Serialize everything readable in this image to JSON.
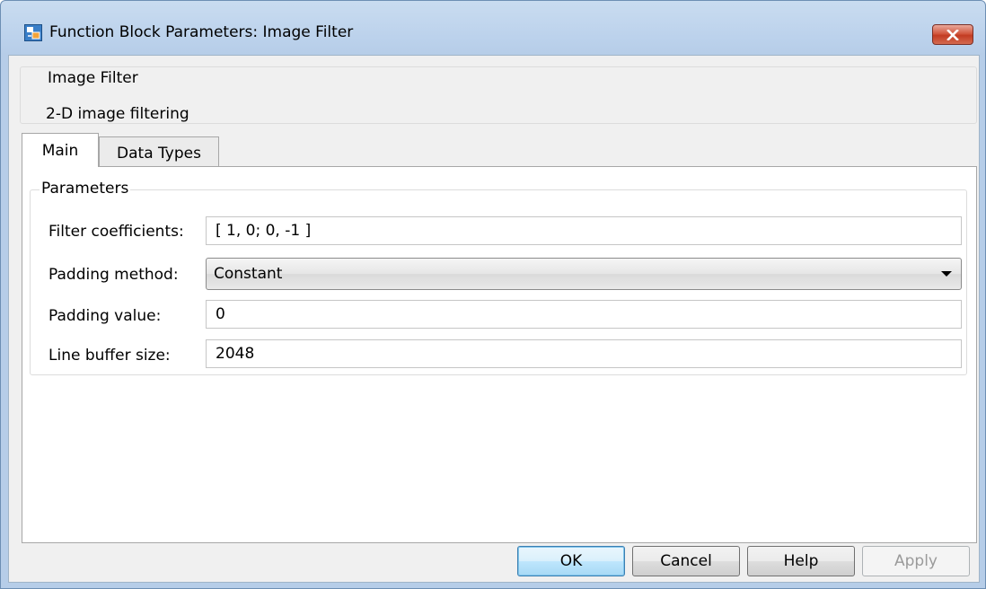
{
  "window": {
    "title": "Function Block Parameters: Image Filter"
  },
  "description": {
    "block_name": "Image Filter",
    "text": "2-D image filtering"
  },
  "tabs": [
    {
      "label": "Main",
      "selected": true
    },
    {
      "label": "Data Types",
      "selected": false
    }
  ],
  "parameters": {
    "group_label": "Parameters",
    "filter_coefficients": {
      "label": "Filter coefficients:",
      "value": "[ 1, 0; 0, -1 ]"
    },
    "padding_method": {
      "label": "Padding method:",
      "value": "Constant"
    },
    "padding_value": {
      "label": "Padding value:",
      "value": "0"
    },
    "line_buffer_size": {
      "label": "Line buffer size:",
      "value": "2048"
    }
  },
  "buttons": {
    "ok": "OK",
    "cancel": "Cancel",
    "help": "Help",
    "apply": "Apply"
  },
  "icons": {
    "app": "simulink-block-icon",
    "close": "close-icon",
    "dropdown": "chevron-down-icon"
  }
}
